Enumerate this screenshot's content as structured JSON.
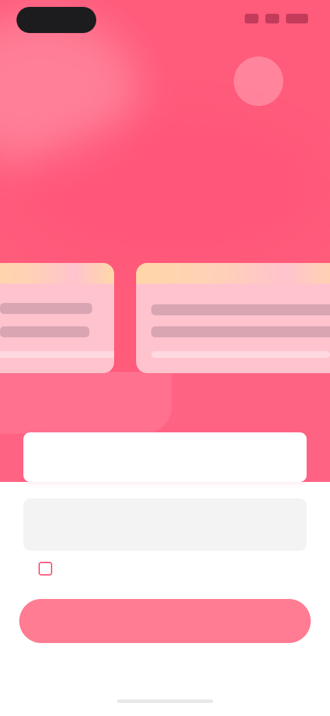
{
  "hero": {
    "title": "",
    "action_icon": "circle-button-icon"
  },
  "cards": [
    {
      "label": "",
      "line1": "",
      "line2": ""
    },
    {
      "label": "",
      "line1": "",
      "line2": ""
    }
  ],
  "form": {
    "field1": {
      "label": "",
      "value": "",
      "placeholder": ""
    },
    "field2": {
      "label": "",
      "value": "",
      "placeholder": ""
    },
    "terms_text": "",
    "primary_button_label": "",
    "footer_link": ""
  },
  "colors": {
    "brand": "#ff5b7b",
    "button": "#ff7c93",
    "card": "#ffc3cd"
  }
}
